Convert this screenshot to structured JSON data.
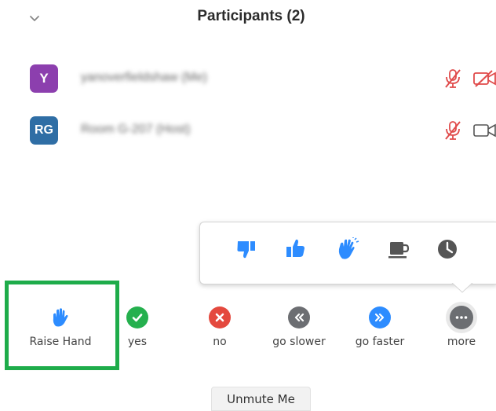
{
  "header": {
    "title": "Participants (2)",
    "collapse_icon": "chevron-down-icon"
  },
  "participants": [
    {
      "initials": "Y",
      "name": "yanoverfieldshaw (Me)",
      "color": "#8c3fae",
      "mic": "muted",
      "video": "off"
    },
    {
      "initials": "RG",
      "name": "Room G-207 (Host)",
      "color": "#2f6ea5",
      "mic": "muted",
      "video": "on"
    }
  ],
  "reactions": [
    {
      "icon": "thumbs-down-icon",
      "color": "#2d8cff"
    },
    {
      "icon": "thumbs-up-icon",
      "color": "#2d8cff"
    },
    {
      "icon": "clap-icon",
      "color": "#2d8cff"
    },
    {
      "icon": "coffee-cup-icon",
      "color": "#555555"
    },
    {
      "icon": "clock-icon",
      "color": "#555555"
    }
  ],
  "feedback": {
    "raise_hand": "Raise Hand",
    "yes": "yes",
    "no": "no",
    "go_slower": "go slower",
    "go_faster": "go faster",
    "more": "more"
  },
  "colors": {
    "highlight": "#1eac4a",
    "yes": "#25b04e",
    "no": "#e4493e",
    "go_slower": "#6c6e72",
    "go_faster": "#2d8cff",
    "more": "#6c6e72"
  },
  "unmute_label": "Unmute Me"
}
